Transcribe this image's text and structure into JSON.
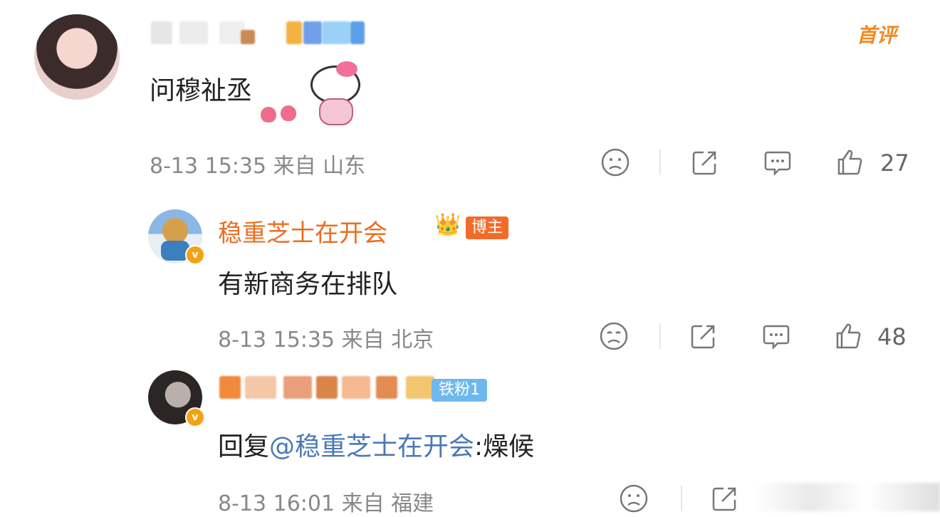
{
  "colors": {
    "name_orange": "#ec6d20",
    "mention_blue": "#4a78b8",
    "meta_gray": "#888888",
    "host_badge": "#f26b2a",
    "fan_badge": "#6fb8ef"
  },
  "comment1": {
    "badge": "首评",
    "text": "问穆祉丞",
    "meta": "8-13 15:35 来自 山东",
    "like_count": "27",
    "icons": [
      "sad-face-icon",
      "share-icon",
      "reply-icon",
      "like-icon"
    ]
  },
  "comment2": {
    "name": "稳重芝士在开会",
    "host_label": "博主",
    "text": "有新商务在排队",
    "meta": "8-13 15:35 来自 北京",
    "like_count": "48",
    "icons": [
      "sad-face-icon",
      "share-icon",
      "reply-icon",
      "like-icon"
    ]
  },
  "comment3": {
    "fan_label": "铁粉1",
    "text_prefix": "回复",
    "mention": "@稳重芝士在开会",
    "text_suffix": ":燥候",
    "meta": "8-13 16:01 来自 福建",
    "icons": [
      "sad-face-icon",
      "share-icon",
      "reply-icon"
    ]
  }
}
